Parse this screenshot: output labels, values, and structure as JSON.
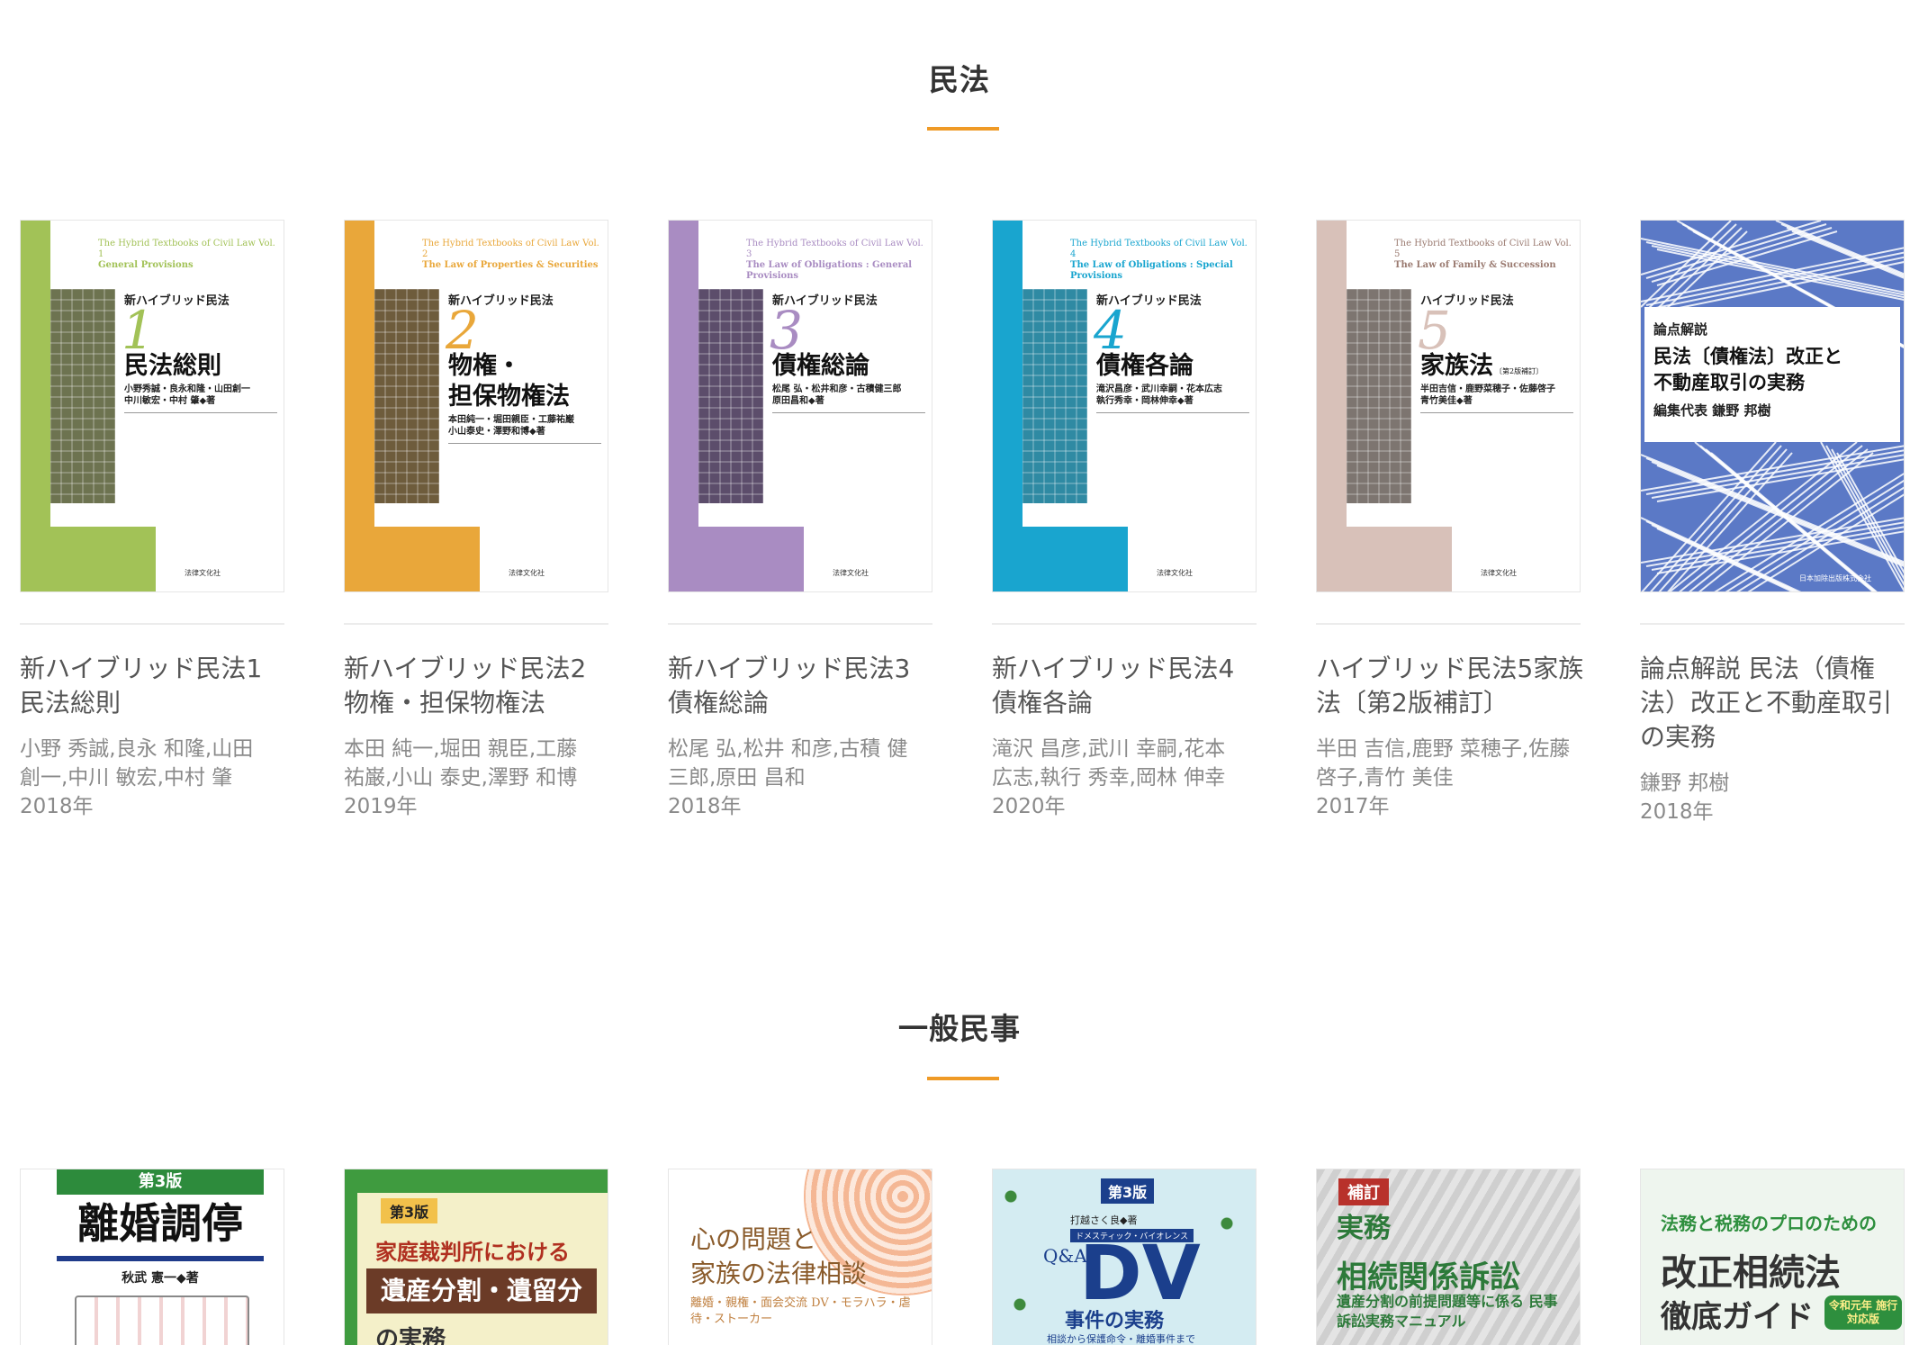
{
  "sections": [
    {
      "title": "民法",
      "books": [
        {
          "title_lines": [
            "新ハイブリッド民法1",
            "民法総則"
          ],
          "authors_lines": [
            "小野 秀誠,良永 和隆,山田",
            "創一,中川 敏宏,中村 肇"
          ],
          "year": "2018年",
          "cover": {
            "series_en": "The Hybrid Textbooks of Civil Law Vol. 1",
            "subtitle_en": "General Provisions",
            "series_ja": "新ハイブリッド民法",
            "number": "1",
            "main_lines": [
              "民法総則"
            ],
            "authors_lines": [
              "小野秀誠・良永和隆・山田創一",
              "中川敏宏・中村 肇◆著"
            ],
            "publisher": "法律文化社",
            "accent": "#a2c257",
            "grid_color": "#6d7350"
          }
        },
        {
          "title_lines": [
            "新ハイブリッド民法2",
            "物権・担保物権法"
          ],
          "authors_lines": [
            "本田 純一,堀田 親臣,工藤",
            "祐巌,小山 泰史,澤野 和博"
          ],
          "year": "2019年",
          "cover": {
            "series_en": "The Hybrid Textbooks of Civil Law Vol. 2",
            "subtitle_en": "The Law of Properties & Securities",
            "series_ja": "新ハイブリッド民法",
            "number": "2",
            "main_lines": [
              "物権・",
              "担保物権法"
            ],
            "authors_lines": [
              "本田純一・堀田親臣・工藤祐巌",
              "小山泰史・澤野和博◆著"
            ],
            "publisher": "法律文化社",
            "accent": "#e9a73a",
            "grid_color": "#6e5c3c"
          }
        },
        {
          "title_lines": [
            "新ハイブリッド民法3",
            "債権総論"
          ],
          "authors_lines": [
            "松尾 弘,松井 和彦,古積 健",
            "三郎,原田 昌和"
          ],
          "year": "2018年",
          "cover": {
            "series_en": "The Hybrid Textbooks of Civil Law Vol. 3",
            "subtitle_en": "The Law of Obligations : General Provisions",
            "series_ja": "新ハイブリッド民法",
            "number": "3",
            "main_lines": [
              "債権総論"
            ],
            "authors_lines": [
              "松尾 弘・松井和彦・古積健三郎",
              "原田昌和◆著"
            ],
            "publisher": "法律文化社",
            "accent": "#a98cc2",
            "grid_color": "#5c4d6b"
          }
        },
        {
          "title_lines": [
            "新ハイブリッド民法4",
            "債権各論"
          ],
          "authors_lines": [
            "滝沢 昌彦,武川 幸嗣,花本",
            "広志,執行 秀幸,岡林 伸幸"
          ],
          "year": "2020年",
          "cover": {
            "series_en": "The Hybrid Textbooks of Civil Law Vol. 4",
            "subtitle_en": "The Law of Obligations : Special Provisions",
            "series_ja": "新ハイブリッド民法",
            "number": "4",
            "main_lines": [
              "債権各論"
            ],
            "authors_lines": [
              "滝沢昌彦・武川幸嗣・花本広志",
              "執行秀幸・岡林伸幸◆著"
            ],
            "publisher": "法律文化社",
            "accent": "#19a5cf",
            "grid_color": "#2f8aa3"
          }
        },
        {
          "title_lines": [
            "ハイブリッド民法5家族",
            "法〔第2版補訂〕"
          ],
          "authors_lines": [
            "半田 吉信,鹿野 菜穂子,佐藤",
            "啓子,青竹 美佳"
          ],
          "year": "2017年",
          "cover": {
            "series_en": "The Hybrid Textbooks of Civil Law Vol. 5",
            "subtitle_en": "The Law of Family & Succession",
            "series_ja": "ハイブリッド民法",
            "number": "5",
            "main_lines": [
              "家族法"
            ],
            "edition": "〔第2版補訂〕",
            "authors_lines": [
              "半田吉信・鹿野菜穂子・佐藤啓子",
              "青竹美佳◆著"
            ],
            "publisher": "法律文化社",
            "accent": "#d8c1b9",
            "grid_color": "#7d7570"
          }
        },
        {
          "title_lines": [
            "論点解説 民法（債権",
            "法）改正と不動産取引",
            "の実務"
          ],
          "authors_lines": [
            "鎌野 邦樹"
          ],
          "year": "2018年",
          "cover": {
            "small": "論点解説",
            "main_lines": [
              "民法〔債権法〕改正と",
              "不動産取引の実務"
            ],
            "editor": "編集代表 鎌野 邦樹",
            "publisher": "日本加除出版株式会社",
            "accent": "#5b79c6"
          }
        }
      ]
    },
    {
      "title": "一般民事",
      "covers": [
        {
          "edition": "第3版",
          "main": "離婚調停",
          "author": "秋武 憲一◆著",
          "accent": "#2d8b3c",
          "band2": "#1f3b8a"
        },
        {
          "edition": "第3版",
          "lines": [
            "家庭裁判所における",
            "遺産分割・遺留分",
            "の実務"
          ],
          "accent": "#3f9b3f"
        },
        {
          "lines": [
            "心の問題と",
            "家族の法律相談"
          ],
          "sub": "離婚・親権・面会交流 DV・モラハラ・虐待・ストーカー",
          "accent": "#f2a57a"
        },
        {
          "edition": "第3版",
          "author": "打越さく良◆著",
          "kicker": "ドメスティック・バイオレンス",
          "qa": "Q&A",
          "main": "DV",
          "sub": "事件の実務",
          "tail": "相談から保護命令・離婚事件まで",
          "accent": "#d4ecf2"
        },
        {
          "badge": "補訂",
          "lines": [
            "実務",
            "相続関係訴訟"
          ],
          "sub": "遺産分割の前提問題等に係る 民事訴訟実務マニュアル",
          "accent": "#2d7a3a"
        },
        {
          "kicker": "法務と税務のプロのための",
          "lines": [
            "改正相続法",
            "徹底ガイド"
          ],
          "badge": "令和元年 施行 対応版",
          "accent": "#2e8f3e"
        }
      ]
    }
  ]
}
